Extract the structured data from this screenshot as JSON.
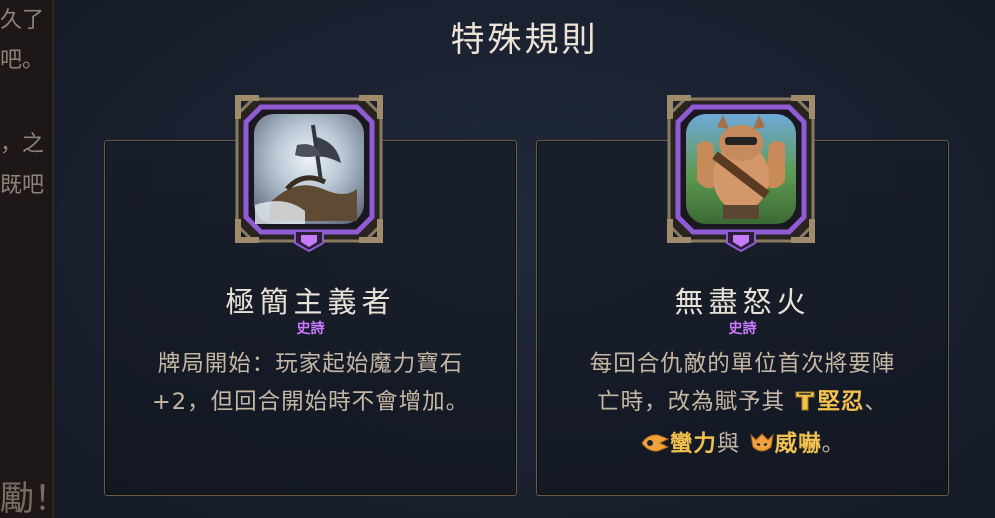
{
  "left_panel": {
    "lines": [
      "久了",
      "吧。",
      "，之",
      "既吧",
      "勵！"
    ]
  },
  "title": "特殊規則",
  "cards": [
    {
      "name": "極簡主義者",
      "rarity": "史詩",
      "desc_lines": [
        "牌局開始：玩家起始魔力寶石",
        "+2，但回合開始時不會增加。"
      ],
      "icon": "ship-wreck-icon"
    },
    {
      "name": "無盡怒火",
      "rarity": "史詩",
      "desc_line1": "每回合仇敵的單位首次將要陣",
      "desc_line2_prefix": "亡時，改為賦予其",
      "keyword_1": "堅忍",
      "sep_1": "、",
      "keyword_2": "蠻力",
      "join": "與",
      "keyword_3": "威嚇",
      "end": "。",
      "icon": "muscular-yordle-icon"
    }
  ],
  "colors": {
    "background": "#1b2230",
    "card_border": "#6c5a41",
    "title": "#ece3d6",
    "rarity_epic": "#c97bff",
    "keyword": "#f2c14e",
    "frame_purple": "#8f5cd6"
  }
}
